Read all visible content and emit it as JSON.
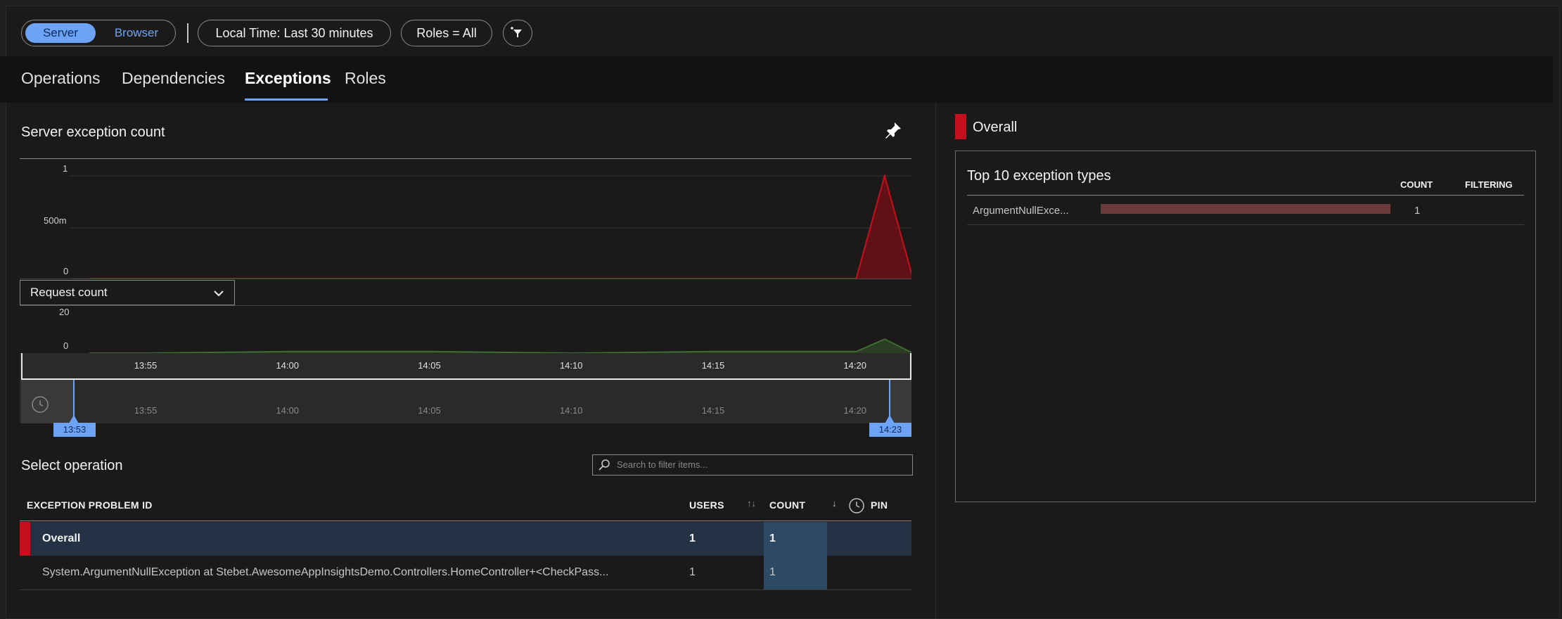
{
  "toolbar": {
    "server_label": "Server",
    "browser_label": "Browser",
    "time_filter": "Local Time: Last 30 minutes",
    "roles_filter": "Roles = All"
  },
  "tabs": [
    {
      "label": "Operations",
      "selected": false
    },
    {
      "label": "Dependencies",
      "selected": false
    },
    {
      "label": "Exceptions",
      "selected": true
    },
    {
      "label": "Roles",
      "selected": false
    }
  ],
  "exception_chart": {
    "title": "Server exception count",
    "y_ticks": [
      "1",
      "500m",
      "0"
    ]
  },
  "request_chart": {
    "selector_value": "Request count",
    "y_ticks": [
      "20",
      "0"
    ]
  },
  "time_axis": {
    "ticks": [
      "13:55",
      "14:00",
      "14:05",
      "14:10",
      "14:15",
      "14:20"
    ]
  },
  "brush": {
    "ticks": [
      "13:55",
      "14:00",
      "14:05",
      "14:10",
      "14:15",
      "14:20"
    ],
    "start_label": "13:53",
    "end_label": "14:23"
  },
  "operations": {
    "title": "Select operation",
    "search_placeholder": "Search to filter items...",
    "columns": {
      "problem_id": "EXCEPTION PROBLEM ID",
      "users": "USERS",
      "count": "COUNT",
      "pin": "PIN"
    },
    "rows": [
      {
        "id": "Overall",
        "users": "1",
        "count": "1"
      },
      {
        "id": "System.ArgumentNullException at Stebet.AwesomeAppInsightsDemo.Controllers.HomeController+<CheckPass...",
        "users": "1",
        "count": "1"
      }
    ]
  },
  "right_panel": {
    "heading": "Overall",
    "table_title": "Top 10 exception types",
    "col_count": "COUNT",
    "col_filtering": "FILTERING",
    "rows": [
      {
        "name": "ArgumentNullExce...",
        "count": "1",
        "fraction": 1.0
      }
    ]
  },
  "colors": {
    "accent": "#6ca3f5",
    "exception_red": "#c50f1f",
    "request_green": "#3a5a2f",
    "selected_row": "#253245"
  },
  "chart_data": [
    {
      "type": "area",
      "title": "Server exception count",
      "x": [
        "13:53",
        "13:55",
        "14:00",
        "14:05",
        "14:10",
        "14:15",
        "14:20",
        "14:21",
        "14:22",
        "14:23"
      ],
      "series": [
        {
          "values": [
            0,
            0,
            0,
            0,
            0,
            0,
            0,
            1,
            0,
            0
          ]
        }
      ],
      "ylim": [
        0,
        1
      ],
      "y_ticks": [
        "0",
        "500m",
        "1"
      ]
    },
    {
      "type": "area",
      "title": "Request count",
      "x": [
        "13:53",
        "13:55",
        "14:00",
        "14:05",
        "14:10",
        "14:15",
        "14:20",
        "14:21",
        "14:22",
        "14:23"
      ],
      "series": [
        {
          "values": [
            0,
            0,
            1,
            1,
            0,
            1,
            1,
            9,
            0,
            0
          ]
        }
      ],
      "ylim": [
        0,
        20
      ],
      "y_ticks": [
        "0",
        "20"
      ]
    }
  ]
}
